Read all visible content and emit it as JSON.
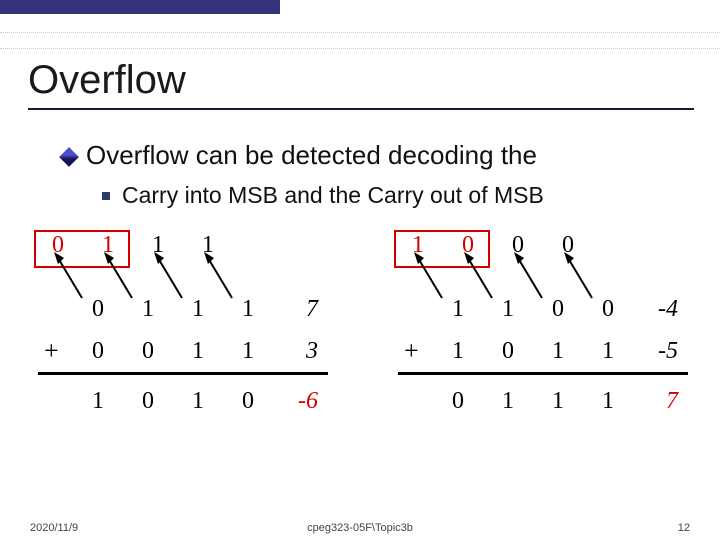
{
  "slide": {
    "title": "Overflow",
    "bullet_main": "Overflow can be detected decoding the",
    "bullet_sub": "Carry into MSB and the Carry out of MSB"
  },
  "figure": {
    "left": {
      "carry_into_msb": "0",
      "carry_out_msb": "1",
      "carry_rest": [
        "1",
        "1"
      ],
      "row_a": [
        "0",
        "1",
        "1",
        "1"
      ],
      "row_b": [
        "0",
        "0",
        "1",
        "1"
      ],
      "row_sum": [
        "1",
        "0",
        "1",
        "0"
      ],
      "val_a": "7",
      "val_b": "3",
      "val_sum": "-6"
    },
    "right": {
      "carry_into_msb": "1",
      "carry_out_msb": "0",
      "carry_rest": [
        "0",
        "0"
      ],
      "row_a": [
        "1",
        "1",
        "0",
        "0"
      ],
      "row_b": [
        "1",
        "0",
        "1",
        "1"
      ],
      "row_sum": [
        "0",
        "1",
        "1",
        "1"
      ],
      "val_a": "-4",
      "val_b": "-5",
      "val_sum": "7"
    }
  },
  "footer": {
    "date": "2020/11/9",
    "middle": "cpeg323-05F\\Topic3b",
    "page": "12"
  }
}
